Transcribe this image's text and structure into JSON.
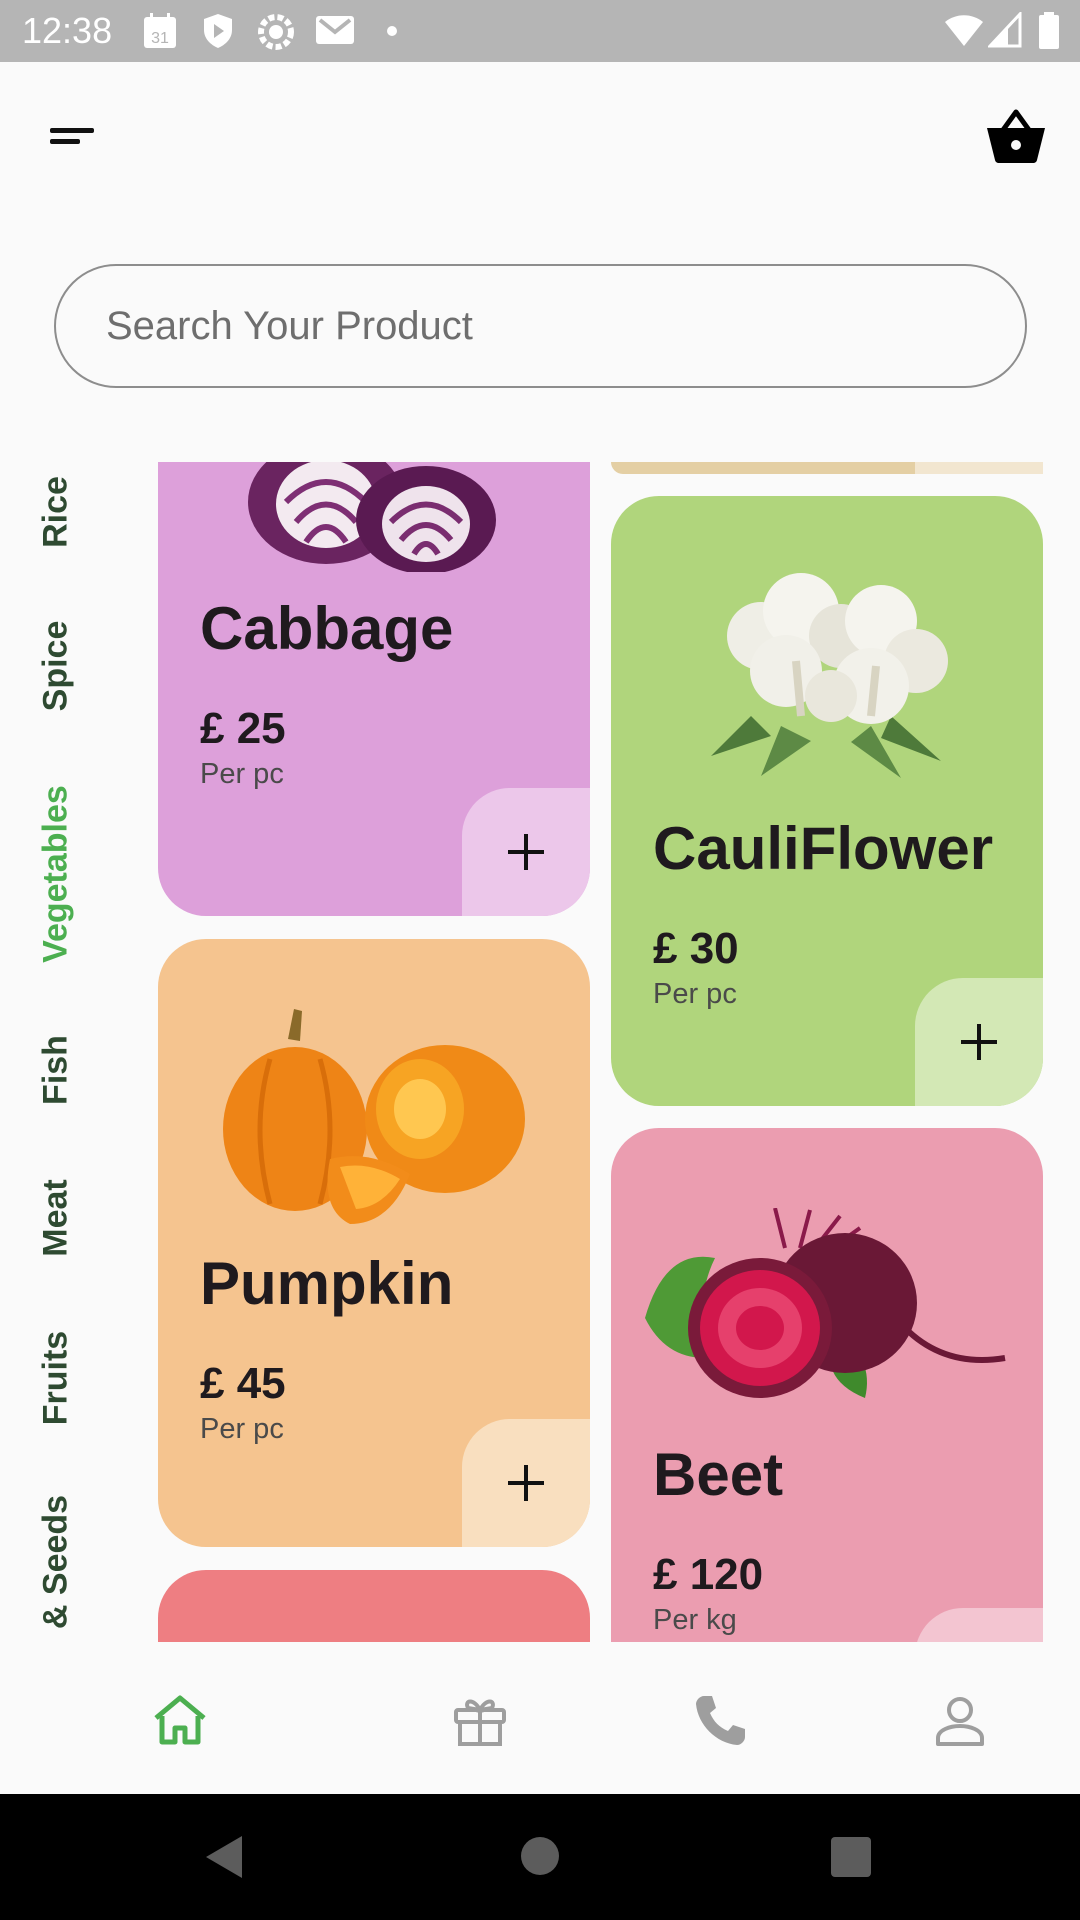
{
  "status_bar": {
    "time": "12:38",
    "icons": [
      "calendar-icon",
      "shield-icon",
      "settings-icon",
      "gmail-icon",
      "dot-icon",
      "wifi-icon",
      "signal-icon",
      "battery-icon"
    ],
    "calendar_day": "31"
  },
  "header": {
    "menu_icon": "menu-icon",
    "cart_icon": "basket-icon"
  },
  "search": {
    "placeholder": "Search Your Product"
  },
  "categories": [
    {
      "label": "Rice"
    },
    {
      "label": "Spice"
    },
    {
      "label": "Vegetables",
      "active": true
    },
    {
      "label": "Fish"
    },
    {
      "label": "Meat"
    },
    {
      "label": "Fruits"
    },
    {
      "label": "& Seeds"
    }
  ],
  "products": [
    {
      "name": "Cabbage",
      "price": "£ 25",
      "unit": "Per pc",
      "color": "#dda0da",
      "add_color": "#ecc7ea"
    },
    {
      "name": "CauliFlower",
      "price": "£ 30",
      "unit": "Per pc",
      "color": "#b0d57c",
      "add_color": "#d3e8b5"
    },
    {
      "name": "Pumpkin",
      "price": "£ 45",
      "unit": "Per pc",
      "color": "#f5c48f",
      "add_color": "#f9dfbf"
    },
    {
      "name": "Beet",
      "price": "£ 120",
      "unit": "Per kg",
      "color": "#eb9db0",
      "add_color": "#f3c5d1"
    }
  ],
  "partial_cards": {
    "top_right_color": "#e4cfa4",
    "bottom_left_color": "#ee7e82"
  },
  "bottom_nav": {
    "items": [
      "home-icon",
      "gift-icon",
      "phone-icon",
      "profile-icon"
    ],
    "active": "home-icon",
    "active_color": "#4caf50",
    "inactive_color": "#9e9e9e"
  },
  "colors": {
    "accent": "#4caf50",
    "category_text": "#2e4a31",
    "background": "#fafafa"
  }
}
